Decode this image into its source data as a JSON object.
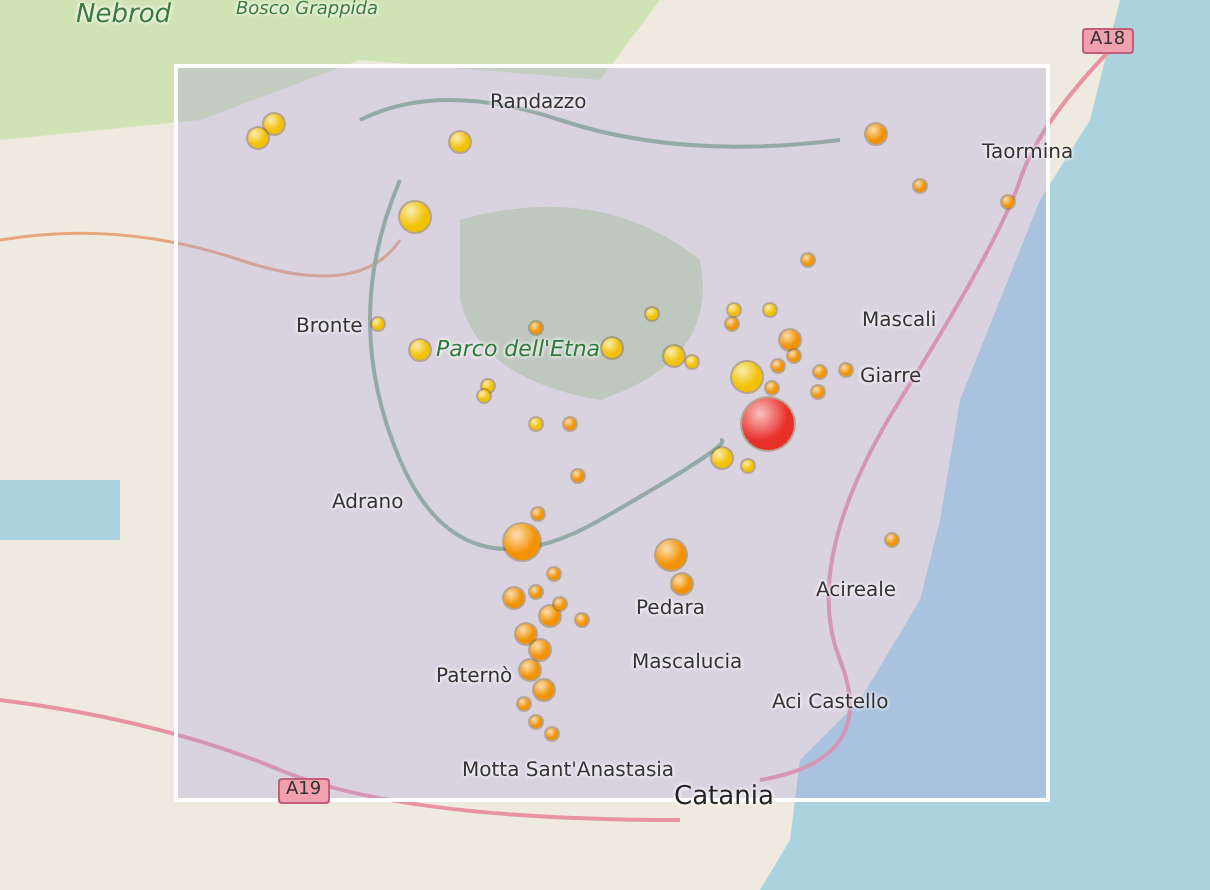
{
  "map": {
    "labels": [
      {
        "text": "Nebrod",
        "kind": "region"
      },
      {
        "text": "Bosco Grappida",
        "kind": "area"
      },
      {
        "text": "A18",
        "kind": "road"
      },
      {
        "text": "Randazzo",
        "kind": "town"
      },
      {
        "text": "Taormina",
        "kind": "town"
      },
      {
        "text": "Bronte",
        "kind": "town"
      },
      {
        "text": "Parco dell'Etna",
        "kind": "park"
      },
      {
        "text": "Mascali",
        "kind": "town"
      },
      {
        "text": "Giarre",
        "kind": "town"
      },
      {
        "text": "Adrano",
        "kind": "town"
      },
      {
        "text": "Pedara",
        "kind": "town"
      },
      {
        "text": "Acireale",
        "kind": "town"
      },
      {
        "text": "Mascalucia",
        "kind": "town"
      },
      {
        "text": "Paternò",
        "kind": "town"
      },
      {
        "text": "Aci Castello",
        "kind": "town"
      },
      {
        "text": "A19",
        "kind": "road"
      },
      {
        "text": "Motta Sant'Anastasia",
        "kind": "town"
      },
      {
        "text": "Catania",
        "kind": "city"
      }
    ],
    "markers": [
      {
        "color": "#f2c200",
        "kind": "medium"
      },
      {
        "color": "#f2c200",
        "kind": "medium"
      },
      {
        "color": "#f2c200",
        "kind": "medium"
      },
      {
        "color": "#f2c200",
        "kind": "large"
      },
      {
        "color": "#f2c200",
        "kind": "small"
      },
      {
        "color": "#f2c200",
        "kind": "medium"
      },
      {
        "color": "#f2c200",
        "kind": "small"
      },
      {
        "color": "#f2c200",
        "kind": "small"
      },
      {
        "color": "#f2c200",
        "kind": "small"
      },
      {
        "color": "#f2c200",
        "kind": "medium"
      },
      {
        "color": "#f2c200",
        "kind": "medium"
      },
      {
        "color": "#f2c200",
        "kind": "small"
      },
      {
        "color": "#f2c200",
        "kind": "small"
      },
      {
        "color": "#f2c200",
        "kind": "large"
      },
      {
        "color": "#f2c200",
        "kind": "medium"
      },
      {
        "color": "#f2c200",
        "kind": "small"
      },
      {
        "color": "#f2c200",
        "kind": "small"
      },
      {
        "color": "#f2c200",
        "kind": "small"
      },
      {
        "color": "#f39200",
        "kind": "medium"
      },
      {
        "color": "#f39200",
        "kind": "small"
      },
      {
        "color": "#f39200",
        "kind": "small"
      },
      {
        "color": "#f39200",
        "kind": "small"
      },
      {
        "color": "#f39200",
        "kind": "medium"
      },
      {
        "color": "#f39200",
        "kind": "small"
      },
      {
        "color": "#f39200",
        "kind": "small"
      },
      {
        "color": "#f39200",
        "kind": "small"
      },
      {
        "color": "#f39200",
        "kind": "small"
      },
      {
        "color": "#f39200",
        "kind": "small"
      },
      {
        "color": "#f39200",
        "kind": "xlarge"
      },
      {
        "color": "#f39200",
        "kind": "small"
      },
      {
        "color": "#f39200",
        "kind": "large"
      },
      {
        "color": "#f39200",
        "kind": "medium"
      },
      {
        "color": "#f39200",
        "kind": "medium"
      },
      {
        "color": "#f39200",
        "kind": "small"
      },
      {
        "color": "#f39200",
        "kind": "medium"
      },
      {
        "color": "#f39200",
        "kind": "medium"
      },
      {
        "color": "#f39200",
        "kind": "medium"
      },
      {
        "color": "#f39200",
        "kind": "small"
      },
      {
        "color": "#f39200",
        "kind": "small"
      },
      {
        "color": "#f39200",
        "kind": "medium"
      },
      {
        "color": "#f39200",
        "kind": "medium"
      },
      {
        "color": "#f39200",
        "kind": "small"
      },
      {
        "color": "#f39200",
        "kind": "small"
      },
      {
        "color": "#f39200",
        "kind": "small"
      },
      {
        "color": "#f39200",
        "kind": "small"
      },
      {
        "color": "#f39200",
        "kind": "small"
      },
      {
        "color": "#f39200",
        "kind": "small"
      },
      {
        "color": "#f39200",
        "kind": "small"
      },
      {
        "color": "#f39200",
        "kind": "small"
      },
      {
        "color": "#f39200",
        "kind": "small"
      },
      {
        "color": "#f39200",
        "kind": "small"
      },
      {
        "color": "#e8302a",
        "kind": "huge"
      }
    ]
  }
}
